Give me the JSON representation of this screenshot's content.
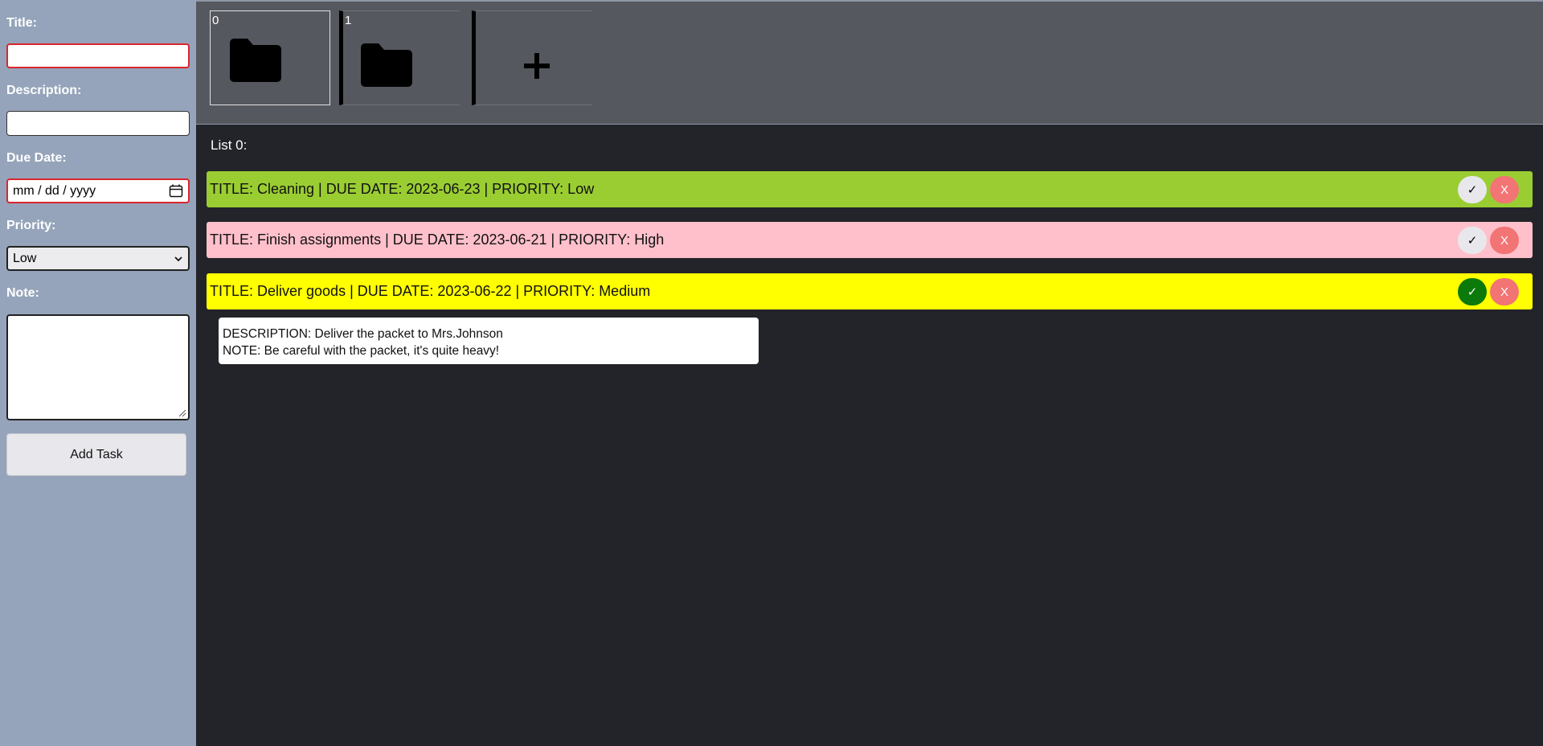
{
  "form": {
    "title_label": "Title:",
    "title_value": "",
    "description_label": "Description:",
    "description_value": "",
    "due_date_label": "Due Date:",
    "due_date_placeholder": "mm / dd / yyyy",
    "priority_label": "Priority:",
    "priority_selected": "Low",
    "note_label": "Note:",
    "note_value": "",
    "add_button_label": "Add Task"
  },
  "folders": [
    {
      "number": "0",
      "active": true
    },
    {
      "number": "1",
      "active": false
    }
  ],
  "list_title": "List 0:",
  "tasks": [
    {
      "text": "TITLE: Cleaning | DUE DATE: 2023-06-23 | PRIORITY: Low",
      "color": "#9acd32",
      "done": false
    },
    {
      "text": "TITLE: Finish assignments | DUE DATE: 2023-06-21 | PRIORITY: High",
      "color": "#ffc0cb",
      "done": false
    },
    {
      "text": "TITLE: Deliver goods | DUE DATE: 2023-06-22 | PRIORITY: Medium",
      "color": "#ffff00",
      "done": true
    }
  ],
  "task_buttons": {
    "check": "✓",
    "delete": "X"
  },
  "detail": {
    "description": "DESCRIPTION: Deliver the packet to Mrs.Johnson",
    "note": "NOTE: Be careful with the packet, it's quite heavy!"
  },
  "icons": {
    "folder": "folder-icon",
    "add": "plus-icon",
    "calendar": "calendar-icon",
    "dropdown": "chevron-down-icon"
  }
}
